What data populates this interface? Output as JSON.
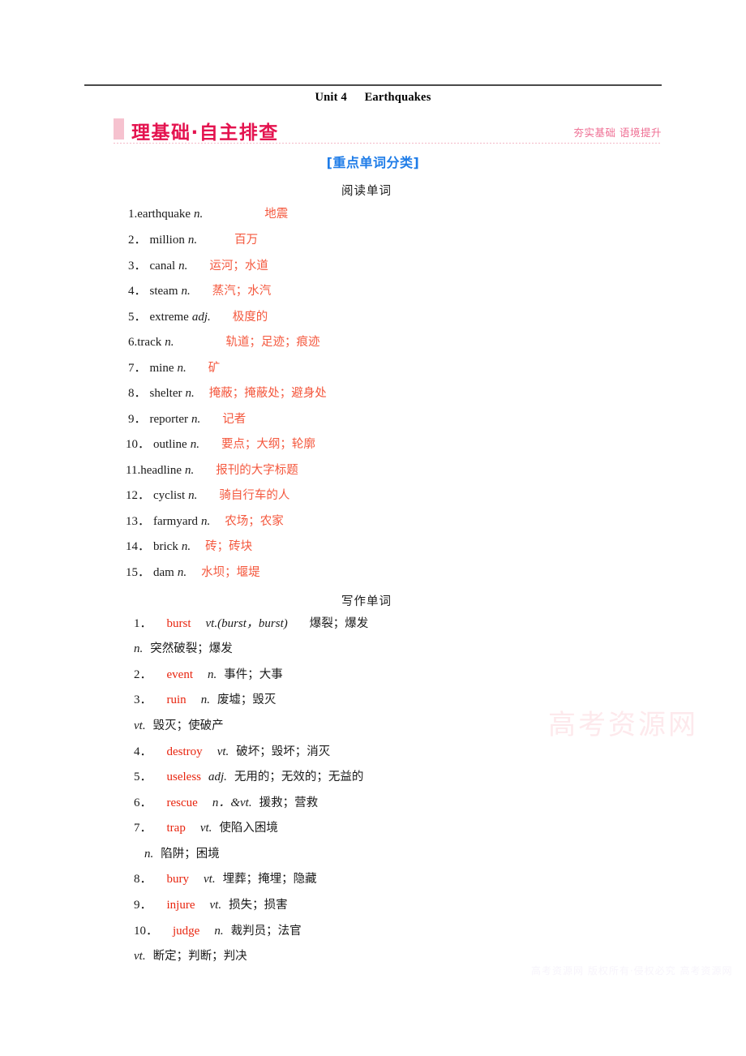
{
  "header": {
    "unit_label": "Unit 4",
    "unit_name": "Earthquakes"
  },
  "banner": {
    "title": "理基础·自主排查",
    "subtitle": "夯实基础 语境提升"
  },
  "blue_heading": "[重点单词分类]",
  "groups": [
    {
      "id": "reading",
      "heading": "阅读单词"
    },
    {
      "id": "writing",
      "heading": "写作单词"
    }
  ],
  "reading_words": [
    {
      "num": "1.",
      "word": "earthquake",
      "pos": "n.",
      "cn": "地震"
    },
    {
      "num": "2．",
      "word": "million",
      "pos": "n.",
      "cn": "百万"
    },
    {
      "num": "3．",
      "word": "canal",
      "pos": "n.",
      "cn": "运河；水道"
    },
    {
      "num": "4．",
      "word": "steam",
      "pos": "n.",
      "cn": "蒸汽；水汽"
    },
    {
      "num": "5．",
      "word": "extreme",
      "pos": "adj.",
      "cn": "极度的"
    },
    {
      "num": "6.",
      "word": "track",
      "pos": "n.",
      "cn": "轨道；足迹；痕迹"
    },
    {
      "num": "7．",
      "word": "mine",
      "pos": "n.",
      "cn": "矿"
    },
    {
      "num": "8．",
      "word": "shelter",
      "pos": "n.",
      "cn": "掩蔽；掩蔽处；避身处"
    },
    {
      "num": "9．",
      "word": "reporter",
      "pos": "n.",
      "cn": "记者"
    },
    {
      "num": "10．",
      "word": "outline",
      "pos": "n.",
      "cn": "要点；大纲；轮廓"
    },
    {
      "num": "11.",
      "word": "headline",
      "pos": "n.",
      "cn": "报刊的大字标题"
    },
    {
      "num": "12．",
      "word": "cyclist",
      "pos": "n.",
      "cn": "骑自行车的人"
    },
    {
      "num": "13．",
      "word": "farmyard",
      "pos": "n.",
      "cn": "农场；农家"
    },
    {
      "num": "14．",
      "word": "brick",
      "pos": "n.",
      "cn": "砖；砖块"
    },
    {
      "num": "15．",
      "word": "dam",
      "pos": "n.",
      "cn": "水坝；堰堤"
    }
  ],
  "writing_words": [
    {
      "num": "1．",
      "word": "burst",
      "pos": "vt.(burst，burst)",
      "cn": "爆裂；爆发",
      "extra_pos": "n.",
      "extra_cn": "突然破裂；爆发"
    },
    {
      "num": "2．",
      "word": "event",
      "pos": "n.",
      "cn": "事件；大事"
    },
    {
      "num": "3．",
      "word": "ruin",
      "pos": "n.",
      "cn": "废墟；毁灭",
      "extra_pos": "vt.",
      "extra_cn": "毁灭；使破产"
    },
    {
      "num": "4．",
      "word": "destroy",
      "pos": "vt.",
      "cn": "破坏；毁坏；消灭"
    },
    {
      "num": "5．",
      "word": "useless",
      "pos": "adj.",
      "cn": "无用的；无效的；无益的"
    },
    {
      "num": "6．",
      "word": "rescue",
      "pos": "n．&vt.",
      "cn": "援救；营救"
    },
    {
      "num": "7．",
      "word": "trap",
      "pos": "vt.",
      "cn": "使陷入困境",
      "extra_pos": "n.",
      "extra_cn": "陷阱；困境"
    },
    {
      "num": "8．",
      "word": "bury",
      "pos": "vt.",
      "cn": "埋葬；掩埋；隐藏"
    },
    {
      "num": "9．",
      "word": "injure",
      "pos": "vt.",
      "cn": "损失；损害"
    },
    {
      "num": "10．",
      "word": "judge",
      "pos": "n.",
      "cn": "裁判员；法官",
      "extra_pos": "vt.",
      "extra_cn": "断定；判断；判决"
    }
  ],
  "watermarks": {
    "main": "高考资源网",
    "footer": "高考资源网 版权所有·侵权必究 高考资源网"
  },
  "colors": {
    "accent_red": "#e4134f",
    "translation_red": "#f4583e",
    "word_red": "#e8250f",
    "heading_blue": "#1e7ce8",
    "banner_pink": "#f6c2cf"
  }
}
